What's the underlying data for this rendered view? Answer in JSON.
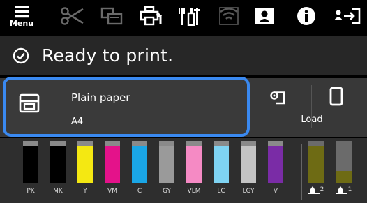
{
  "toolbar": {
    "menu_label": "Menu",
    "icons": [
      "menu-icon",
      "cutter-icon",
      "paper-feed-icon",
      "printer-settings-icon",
      "maintenance-icon",
      "wifi-icon",
      "user-icon",
      "info-icon",
      "sign-in-icon"
    ]
  },
  "status": {
    "text": "Ready to print.",
    "icon": "check-circle-icon"
  },
  "paper": {
    "type": "Plain paper",
    "size": "A4",
    "load_label": "Load",
    "highlight_color": "#3a89f0"
  },
  "inks": [
    {
      "label": "PK",
      "color": "#000000",
      "level": 0.88
    },
    {
      "label": "MK",
      "color": "#000000",
      "level": 0.88
    },
    {
      "label": "Y",
      "color": "#f4e812",
      "level": 0.88
    },
    {
      "label": "VM",
      "color": "#e4128a",
      "level": 0.88
    },
    {
      "label": "C",
      "color": "#1aa6e6",
      "level": 0.88
    },
    {
      "label": "GY",
      "color": "#9a9a9a",
      "level": 0.88
    },
    {
      "label": "VLM",
      "color": "#f58ac4",
      "level": 0.88
    },
    {
      "label": "LC",
      "color": "#7fd3f2",
      "level": 0.88
    },
    {
      "label": "LGY",
      "color": "#c4c4c4",
      "level": 0.88
    },
    {
      "label": "V",
      "color": "#7a2ca6",
      "level": 0.88
    }
  ],
  "maintenance_boxes": [
    {
      "label": "2",
      "color": "#6e6b14",
      "level": 0.88
    },
    {
      "label": "1",
      "color": "#6e6b14",
      "level": 0.28
    }
  ]
}
